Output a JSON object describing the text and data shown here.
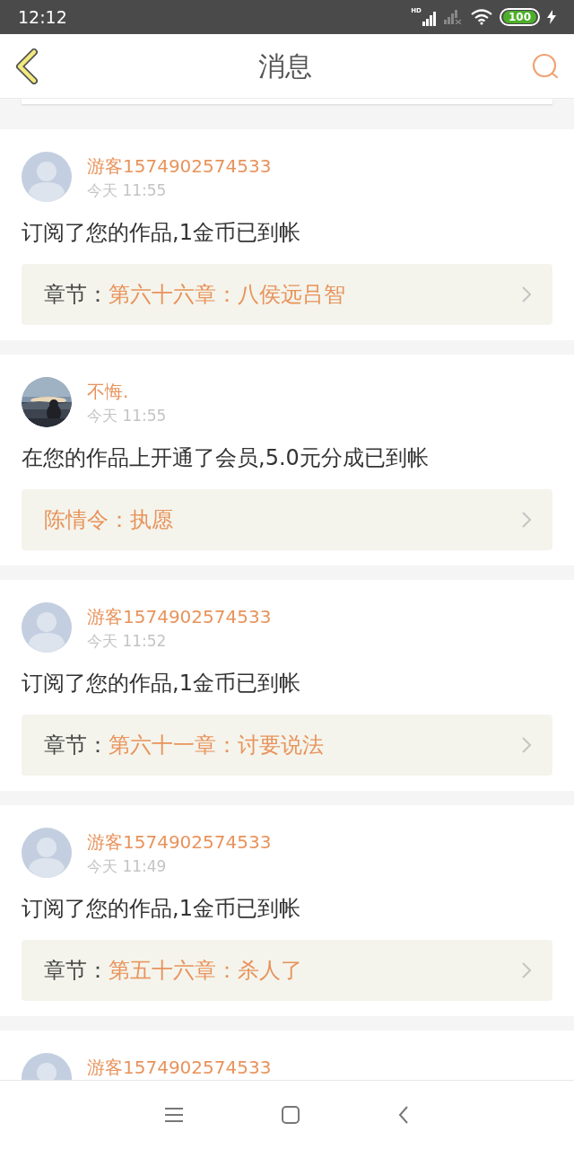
{
  "status_bar": {
    "time": "12:12",
    "signal_label": "HD",
    "battery": "100",
    "charging": true
  },
  "header": {
    "title": "消息"
  },
  "messages": [
    {
      "user": "游客1574902574533",
      "avatar": {
        "kind": "default"
      },
      "time": "今天 11:55",
      "text": "订阅了您的作品,1金币已到帐",
      "link": {
        "label": "章节：",
        "title": "第六十六章：八侯远吕智"
      }
    },
    {
      "user": "不悔.",
      "time": "今天 11:55",
      "text": "在您的作品上开通了会员,5.0元分成已到帐",
      "link": {
        "title": "陈情令：执愿"
      }
    },
    {
      "user": "游客1574902574533",
      "avatar": {
        "kind": "default"
      },
      "time": "今天 11:52",
      "text": "订阅了您的作品,1金币已到帐",
      "link": {
        "label": "章节：",
        "title": "第六十一章：讨要说法"
      }
    },
    {
      "user": "游客1574902574533",
      "avatar": {
        "kind": "default"
      },
      "time": "今天 11:49",
      "text": "订阅了您的作品,1金币已到帐",
      "link": {
        "label": "章节：",
        "title": "第五十六章：杀人了"
      }
    },
    {
      "user": "游客1574902574533",
      "avatar": {
        "kind": "default"
      }
    }
  ]
}
